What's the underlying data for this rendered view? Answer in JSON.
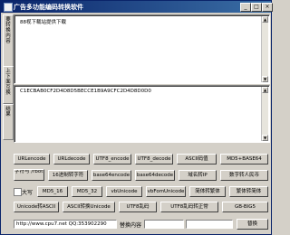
{
  "window": {
    "title": "广告多功能编码转换软件",
    "controls": {
      "minimize": "_",
      "maximize": "□",
      "close": "×"
    }
  },
  "side_tabs": [
    "要转换内容",
    "上下面互换",
    "结果"
  ],
  "panes": {
    "input_text": "88视下载站提供下载",
    "output_text": "C1ECBAB0CF2D4D8D5BECCE1B9A9CFC2D4D8D0D0"
  },
  "buttons": {
    "row1": [
      "URLencode",
      "URLdecode",
      "UTF8_encode",
      "UTF8_decode",
      "ASCII码值",
      "MD5+BASE64"
    ],
    "row2": [
      "字符与 /rbot 转",
      "16进制转字符",
      "base64encode",
      "base64decode",
      "域名转IP",
      "数字转人民币"
    ],
    "row3": [
      "MD5_16",
      "MD5_32",
      "vbUnicode",
      "vbFomUnicode",
      "简体转繁体",
      "繁体转简体"
    ],
    "row4": [
      "Unicode转ASCII",
      "ASCII转换Unicode",
      "UTF8乱码",
      "UTF8乱码转正常",
      "GB-BIG5"
    ]
  },
  "checkbox": {
    "label": "大写",
    "checked": false
  },
  "bottom": {
    "url_value": "http://www.cpu7.net QQ:353902290",
    "replace_label": "替换内容",
    "replace_value": "",
    "replace_with_value": "",
    "replace_button": "替换"
  }
}
